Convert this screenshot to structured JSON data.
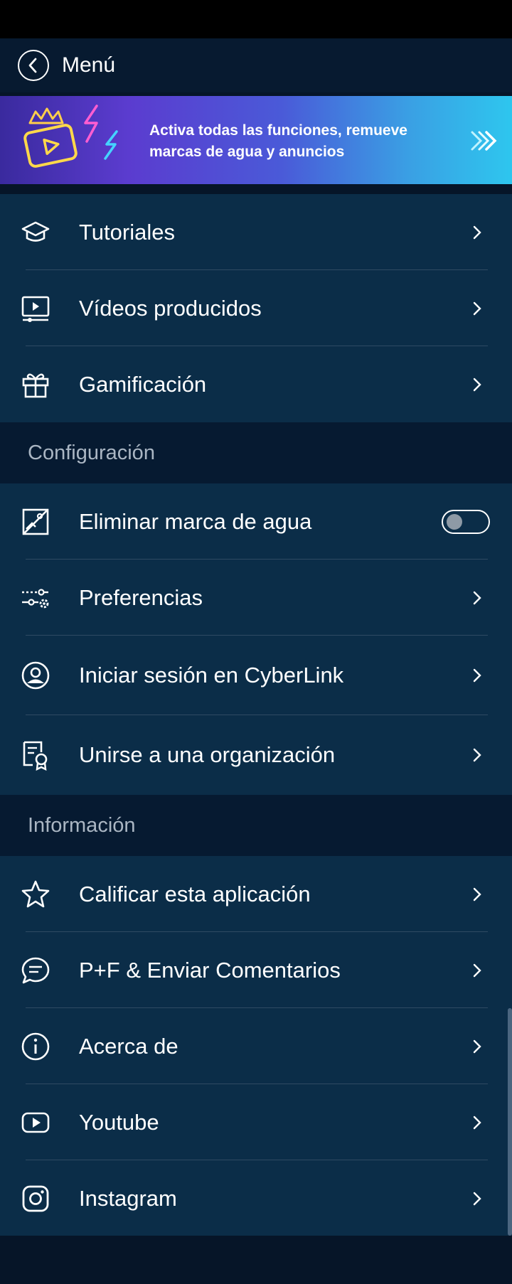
{
  "header": {
    "title": "Menú"
  },
  "promo": {
    "text": "Activa todas las funciones, remueve marcas de agua y anuncios"
  },
  "section1": {
    "items": [
      {
        "label": "Tutoriales",
        "icon": "graduation-cap-icon"
      },
      {
        "label": "Vídeos producidos",
        "icon": "monitor-play-icon"
      },
      {
        "label": "Gamificación",
        "icon": "gift-icon"
      }
    ]
  },
  "config": {
    "title": "Configuración",
    "items": [
      {
        "label": "Eliminar marca de agua",
        "icon": "no-image-icon",
        "toggle": false
      },
      {
        "label": "Preferencias",
        "icon": "sliders-gear-icon"
      },
      {
        "label": "Iniciar sesión en CyberLink",
        "icon": "user-circle-icon"
      },
      {
        "label": "Unirse a una organización",
        "icon": "certificate-icon"
      }
    ]
  },
  "info": {
    "title": "Información",
    "items": [
      {
        "label": "Calificar esta aplicación",
        "icon": "star-icon"
      },
      {
        "label": "P+F & Enviar Comentarios",
        "icon": "chat-bubble-icon"
      },
      {
        "label": "Acerca de",
        "icon": "info-icon"
      },
      {
        "label": "Youtube",
        "icon": "youtube-icon"
      },
      {
        "label": "Instagram",
        "icon": "instagram-icon"
      }
    ]
  },
  "colors": {
    "background": "#0b2d48",
    "section_header": "#061a31",
    "accent_promo_start": "#5b3ccf",
    "accent_promo_end": "#2ec6ee"
  }
}
